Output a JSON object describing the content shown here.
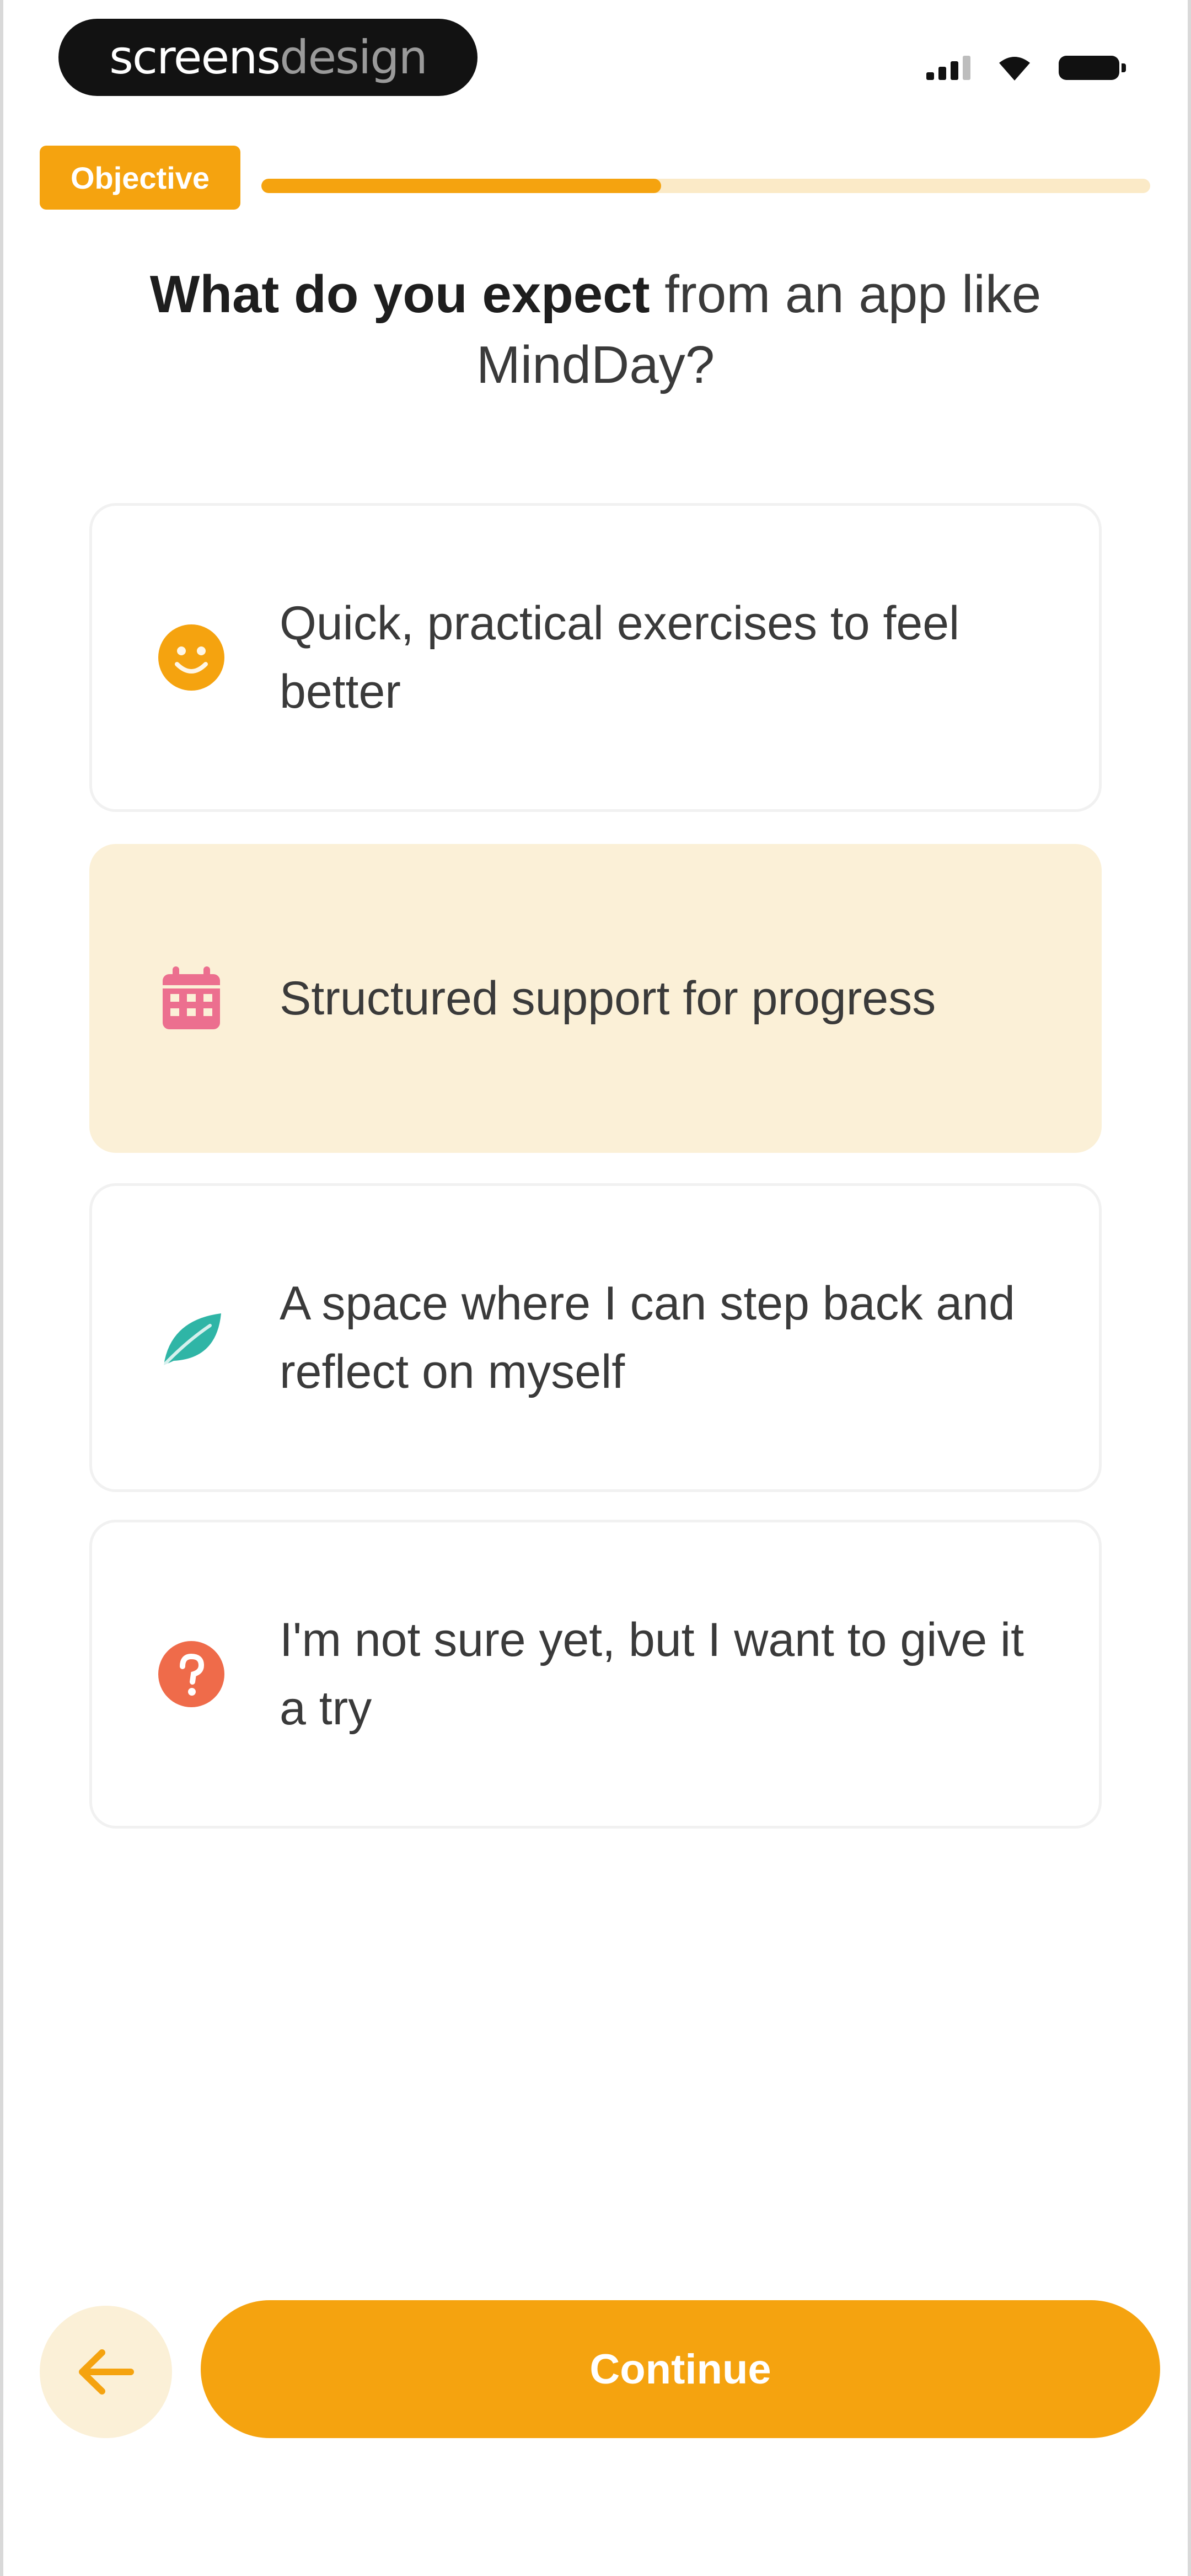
{
  "status_bar": {
    "brand_primary": "screens",
    "brand_secondary": "design"
  },
  "progress": {
    "step_label": "Objective",
    "fraction": 0.45
  },
  "question": {
    "bold": "What do you expect",
    "rest": " from an app like MindDay?"
  },
  "options": [
    {
      "icon": "smiley-face-icon",
      "label": "Quick, practical exercises to feel better",
      "selected": false
    },
    {
      "icon": "calendar-icon",
      "label": "Structured support for progress",
      "selected": true
    },
    {
      "icon": "leaf-icon",
      "label": "A space where I can step back and reflect on myself",
      "selected": false
    },
    {
      "icon": "question-mark-icon",
      "label": "I'm not sure yet, but I want to give it a try",
      "selected": false
    }
  ],
  "actions": {
    "back_icon": "arrow-left-icon",
    "continue_label": "Continue"
  },
  "colors": {
    "accent": "#f5a30f",
    "selected_bg": "#fbf0d7",
    "smiley": "#f5a30f",
    "calendar": "#ec6f8f",
    "leaf": "#2fb5a6",
    "question": "#ef6b4a"
  }
}
